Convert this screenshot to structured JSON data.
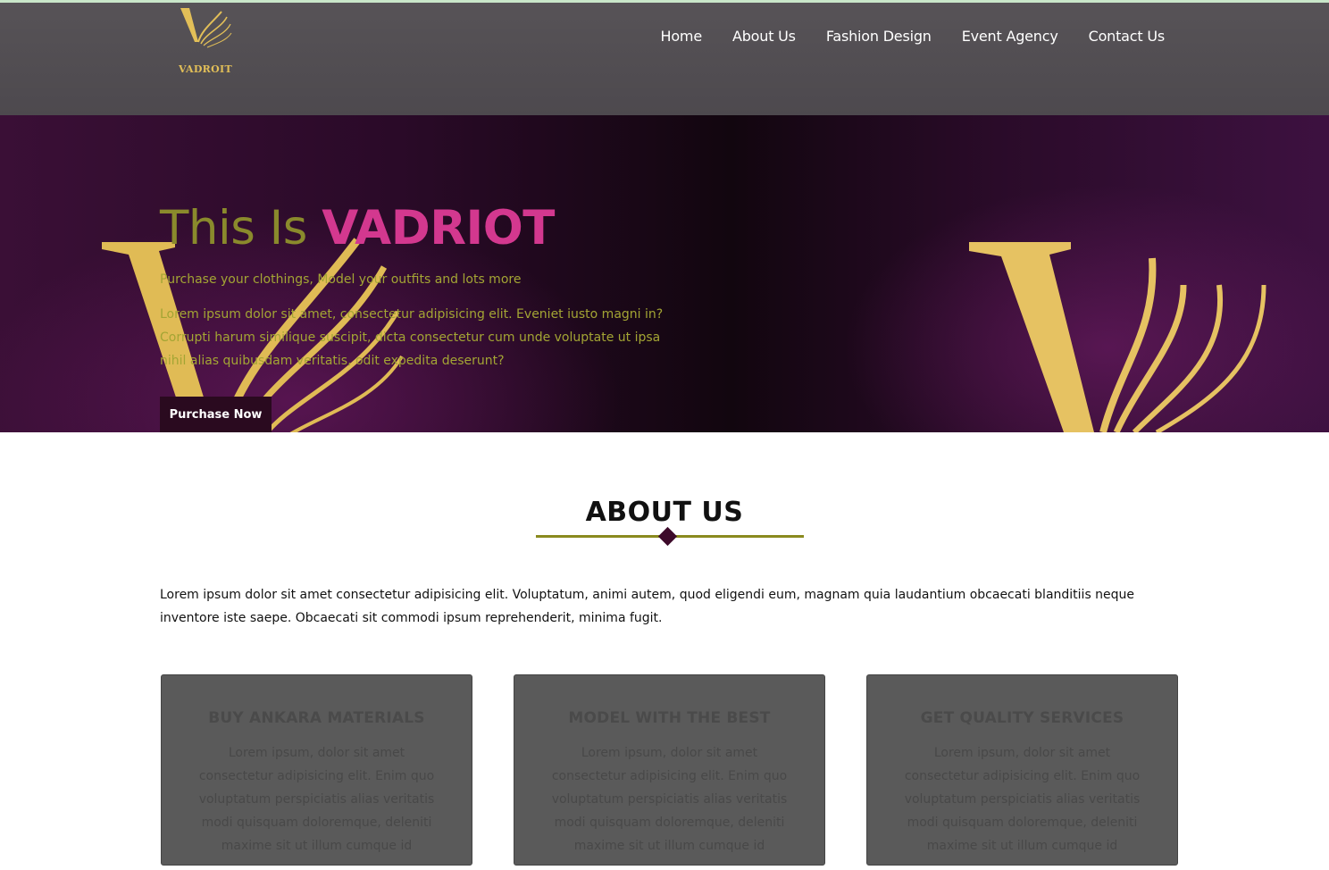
{
  "brand": {
    "logo_text": "VADROIT",
    "gold": "#e2bf58"
  },
  "nav": {
    "items": [
      {
        "label": "Home"
      },
      {
        "label": "About Us"
      },
      {
        "label": "Fashion Design"
      },
      {
        "label": "Event Agency"
      },
      {
        "label": "Contact Us"
      }
    ]
  },
  "hero": {
    "title_prefix": "This Is",
    "title_highlight": "VADRIOT",
    "subtitle": "Purchase your clothings, Model your outfits and lots more",
    "paragraph": "Lorem ipsum dolor sit amet, consectetur adipisicing elit. Eveniet iusto magni in? Corrupti harum similique suscipit, dicta consectetur cum unde voluptate ut ipsa nihil alias quibusdam veritatis, odit expedita deserunt?",
    "button_label": "Purchase Now",
    "colors": {
      "title_prefix": "#8a8a2c",
      "title_highlight": "#d3388f",
      "text": "#a3a534",
      "button": "#2a0a1f"
    }
  },
  "about": {
    "title": "ABOUT US",
    "text": "Lorem ipsum dolor sit amet consectetur adipisicing elit. Voluptatum, animi autem, quod eligendi eum, magnam quia laudantium obcaecati blanditiis neque inventore iste saepe. Obcaecati sit commodi ipsum reprehenderit, minima fugit.",
    "accent_line": "#8a8a1e",
    "diamond": "#3d0a2a"
  },
  "cards": [
    {
      "title": "BUY ANKARA MATERIALS",
      "text": "Lorem ipsum, dolor sit amet consectetur adipisicing elit. Enim quo voluptatum perspiciatis alias veritatis modi quisquam doloremque, deleniti maxime sit ut illum cumque id"
    },
    {
      "title": "MODEL WITH THE BEST",
      "text": "Lorem ipsum, dolor sit amet consectetur adipisicing elit. Enim quo voluptatum perspiciatis alias veritatis modi quisquam doloremque, deleniti maxime sit ut illum cumque id"
    },
    {
      "title": "GET QUALITY SERVICES",
      "text": "Lorem ipsum, dolor sit amet consectetur adipisicing elit. Enim quo voluptatum perspiciatis alias veritatis modi quisquam doloremque, deleniti maxime sit ut illum cumque id"
    }
  ]
}
